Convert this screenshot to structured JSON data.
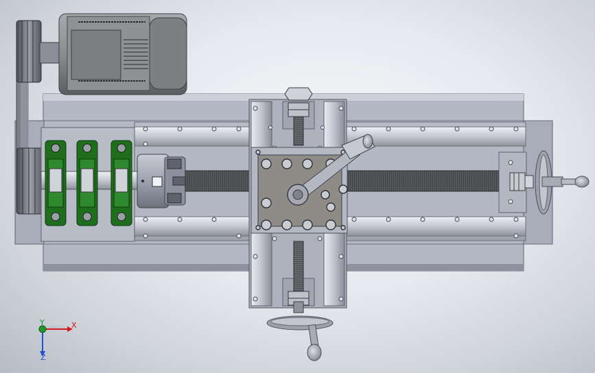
{
  "viewport": {
    "name": "cad-graphics-area",
    "model": "lathe-assembly-top-view"
  },
  "motor": {
    "label_line_1": "",
    "label_line_2": ""
  },
  "triad": {
    "x_label": "X",
    "y_label": "Y",
    "z_label": "Z",
    "x_color": "#d61b1b",
    "y_color": "#1f9a2a",
    "z_color": "#1f4fd6"
  },
  "colors": {
    "bed": "#aeb2bf",
    "bed_dark": "#7f8494",
    "bearing_green": "#1d6f1d",
    "rail": "#c7cad3",
    "screw": "#5d5f63",
    "plate": "#8e8a86",
    "motor": "#8b8d90"
  },
  "icons": {
    "bolt": "hex-bolt",
    "handwheel": "handwheel",
    "chuck": "three-jaw-chuck"
  }
}
